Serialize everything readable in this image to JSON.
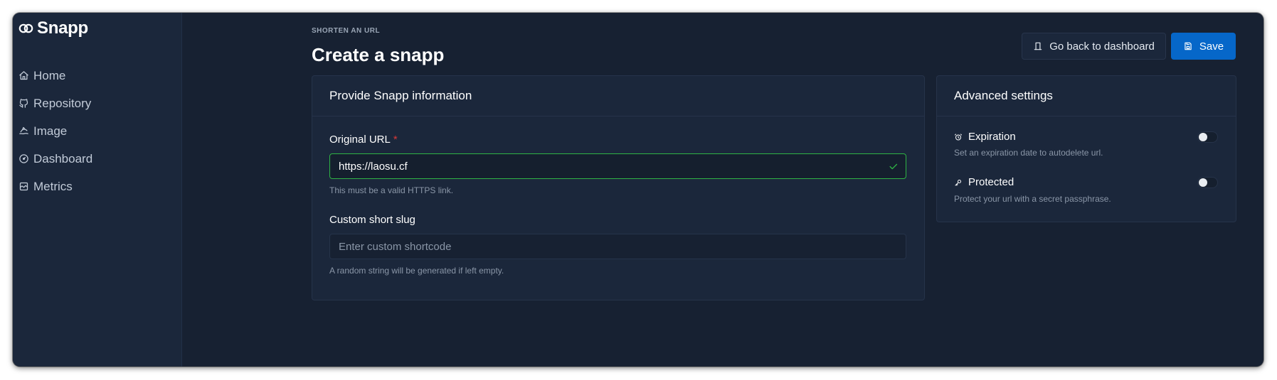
{
  "app": {
    "name": "Snapp"
  },
  "sidebar": {
    "items": [
      {
        "label": "Home",
        "icon": "home-icon"
      },
      {
        "label": "Repository",
        "icon": "github-icon"
      },
      {
        "label": "Image",
        "icon": "image-icon"
      },
      {
        "label": "Dashboard",
        "icon": "dashboard-icon"
      },
      {
        "label": "Metrics",
        "icon": "chart-icon"
      }
    ]
  },
  "header": {
    "pretitle": "SHORTEN AN URL",
    "title": "Create a snapp",
    "back_label": "Go back to dashboard",
    "save_label": "Save"
  },
  "form": {
    "title": "Provide Snapp information",
    "url": {
      "label": "Original URL",
      "required_mark": "*",
      "value": "https://laosu.cf",
      "hint": "This must be a valid HTTPS link."
    },
    "slug": {
      "label": "Custom short slug",
      "placeholder": "Enter custom shortcode",
      "hint": "A random string will be generated if left empty."
    }
  },
  "advanced": {
    "title": "Advanced settings",
    "settings": [
      {
        "label": "Expiration",
        "description": "Set an expiration date to autodelete url.",
        "enabled": false
      },
      {
        "label": "Protected",
        "description": "Protect your url with a secret passphrase.",
        "enabled": false
      }
    ]
  },
  "colors": {
    "background": "#172132",
    "sidebar": "#1b273b",
    "primary": "#0667c9",
    "valid": "#2fb344",
    "required": "#d63939"
  }
}
